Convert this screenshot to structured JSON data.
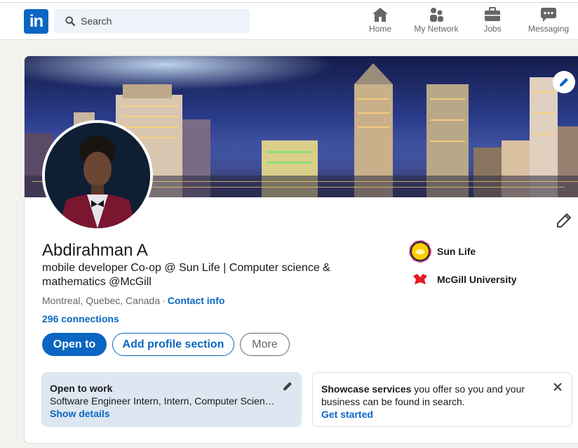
{
  "nav": {
    "logo_text": "in",
    "search_placeholder": "Search",
    "items": [
      {
        "label": "Home",
        "icon": "home-icon"
      },
      {
        "label": "My Network",
        "icon": "people-icon"
      },
      {
        "label": "Jobs",
        "icon": "briefcase-icon"
      },
      {
        "label": "Messaging",
        "icon": "chat-icon"
      }
    ]
  },
  "profile": {
    "name": "Abdirahman A",
    "headline": "mobile developer Co-op @ Sun Life | Computer science & mathematics @McGill",
    "location": "Montreal, Quebec, Canada",
    "separator": "·",
    "contact_info": "Contact info",
    "connections": "296 connections",
    "buttons": {
      "open_to": "Open to",
      "add_section": "Add profile section",
      "more": "More"
    },
    "orgs": [
      {
        "name": "Sun Life",
        "icon": "sunlife-logo"
      },
      {
        "name": "McGill University",
        "icon": "mcgill-logo"
      }
    ]
  },
  "open_to_work": {
    "title": "Open to work",
    "roles": "Software Engineer Intern, Intern, Computer Science Intern",
    "link": "Show details"
  },
  "showcase": {
    "title_bold": "Showcase services",
    "text": " you offer so you and your business can be found in search.",
    "link": "Get started"
  },
  "colors": {
    "brand": "#0a66c2",
    "page_bg": "#f4f2ee",
    "otw_bg": "#dde7f1"
  }
}
